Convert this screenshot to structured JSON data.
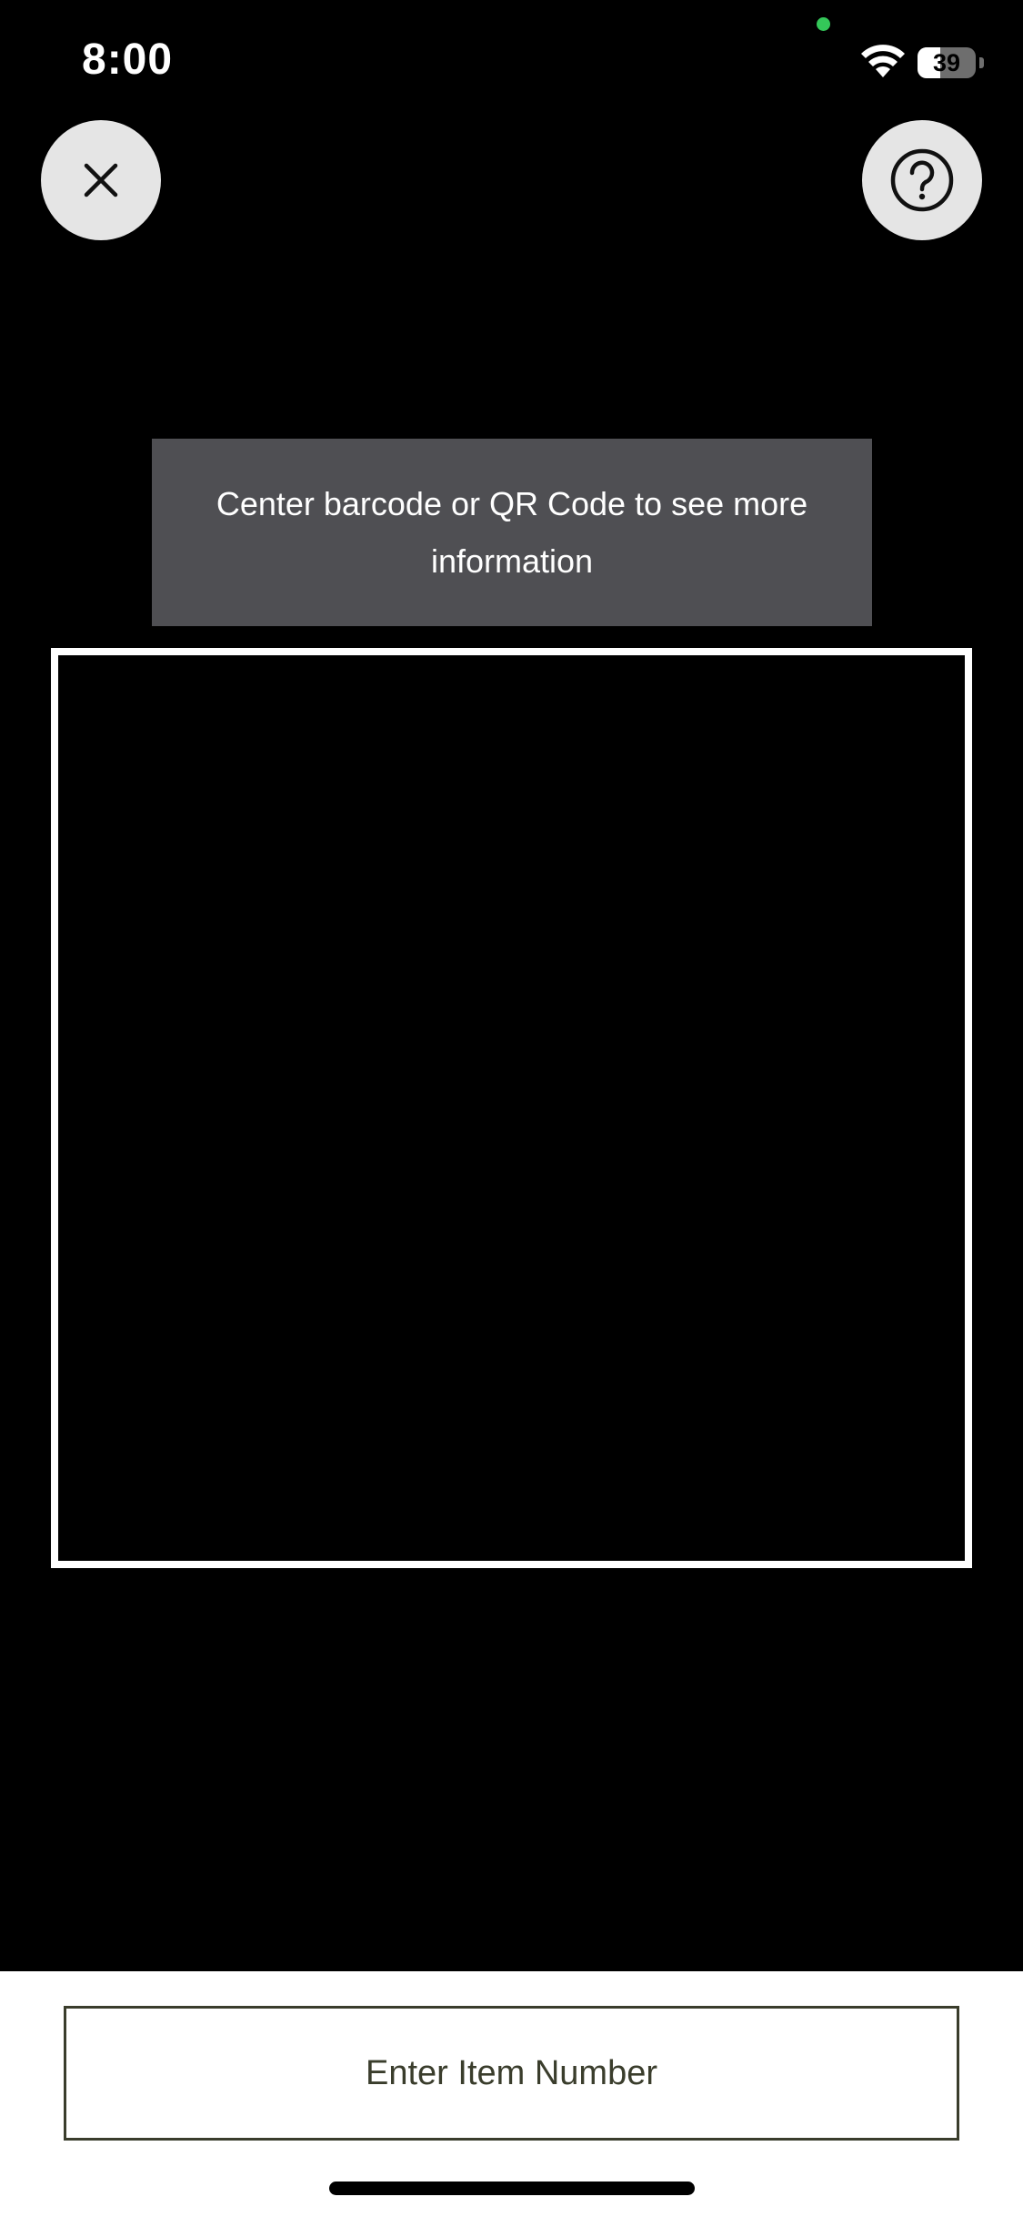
{
  "status_bar": {
    "time": "8:00",
    "battery_percent": "39",
    "battery_level": 0.39,
    "privacy_indicator_color": "#34c759"
  },
  "toolbar": {
    "close_icon": "close-icon",
    "help_icon": "question-circle-icon"
  },
  "scanner": {
    "hint": "Center barcode or QR Code to see more information"
  },
  "bottom": {
    "item_number_placeholder": "Enter Item Number"
  },
  "colors": {
    "background": "#000000",
    "hint_banner": "#4f4f53",
    "button_bg": "#e5e5e5",
    "input_border": "#3a3d2c"
  }
}
